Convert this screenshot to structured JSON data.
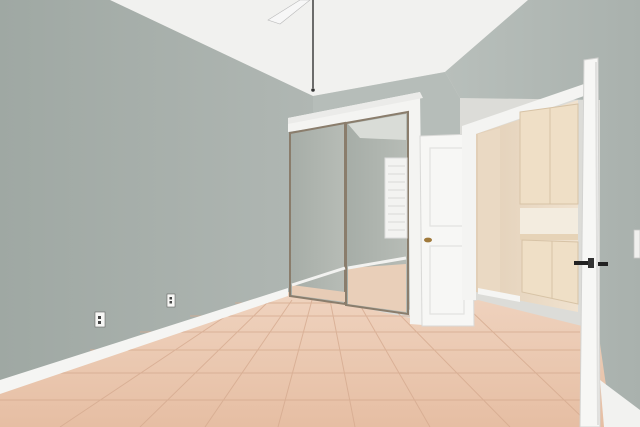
{
  "scene": {
    "description_free": true,
    "colors": {
      "left_wall": "#a9b1ad",
      "right_wall": "#aeb6b2",
      "ceiling": "#f2f2f0",
      "tile": "#e9c4ab",
      "grout": "#d8ad93",
      "trim": "#f4f4f2",
      "mirror": "#a9afa9",
      "mirror_frame": "#8a7d6c",
      "door": "#f7f7f5",
      "cabinet": "#eedfc6",
      "closet_interior": "#e8d8c4"
    },
    "objects": {
      "ceiling_fan": "ceiling-fan",
      "mirrored_closet": "mirrored-closet-doors",
      "bedroom_door": "open-door",
      "closet_door": "open-closet-door",
      "cabinets": "built-in-cabinets",
      "outlets": "wall-outlet",
      "window": "shuttered-window"
    }
  }
}
